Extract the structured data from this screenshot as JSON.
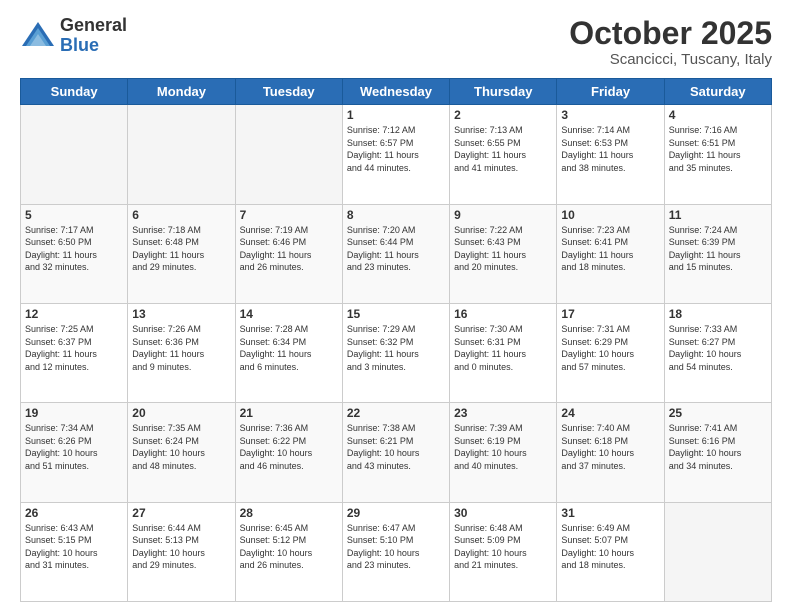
{
  "header": {
    "logo_general": "General",
    "logo_blue": "Blue",
    "month_title": "October 2025",
    "location": "Scancicci, Tuscany, Italy"
  },
  "days_of_week": [
    "Sunday",
    "Monday",
    "Tuesday",
    "Wednesday",
    "Thursday",
    "Friday",
    "Saturday"
  ],
  "weeks": [
    [
      {
        "day": "",
        "info": ""
      },
      {
        "day": "",
        "info": ""
      },
      {
        "day": "",
        "info": ""
      },
      {
        "day": "1",
        "info": "Sunrise: 7:12 AM\nSunset: 6:57 PM\nDaylight: 11 hours\nand 44 minutes."
      },
      {
        "day": "2",
        "info": "Sunrise: 7:13 AM\nSunset: 6:55 PM\nDaylight: 11 hours\nand 41 minutes."
      },
      {
        "day": "3",
        "info": "Sunrise: 7:14 AM\nSunset: 6:53 PM\nDaylight: 11 hours\nand 38 minutes."
      },
      {
        "day": "4",
        "info": "Sunrise: 7:16 AM\nSunset: 6:51 PM\nDaylight: 11 hours\nand 35 minutes."
      }
    ],
    [
      {
        "day": "5",
        "info": "Sunrise: 7:17 AM\nSunset: 6:50 PM\nDaylight: 11 hours\nand 32 minutes."
      },
      {
        "day": "6",
        "info": "Sunrise: 7:18 AM\nSunset: 6:48 PM\nDaylight: 11 hours\nand 29 minutes."
      },
      {
        "day": "7",
        "info": "Sunrise: 7:19 AM\nSunset: 6:46 PM\nDaylight: 11 hours\nand 26 minutes."
      },
      {
        "day": "8",
        "info": "Sunrise: 7:20 AM\nSunset: 6:44 PM\nDaylight: 11 hours\nand 23 minutes."
      },
      {
        "day": "9",
        "info": "Sunrise: 7:22 AM\nSunset: 6:43 PM\nDaylight: 11 hours\nand 20 minutes."
      },
      {
        "day": "10",
        "info": "Sunrise: 7:23 AM\nSunset: 6:41 PM\nDaylight: 11 hours\nand 18 minutes."
      },
      {
        "day": "11",
        "info": "Sunrise: 7:24 AM\nSunset: 6:39 PM\nDaylight: 11 hours\nand 15 minutes."
      }
    ],
    [
      {
        "day": "12",
        "info": "Sunrise: 7:25 AM\nSunset: 6:37 PM\nDaylight: 11 hours\nand 12 minutes."
      },
      {
        "day": "13",
        "info": "Sunrise: 7:26 AM\nSunset: 6:36 PM\nDaylight: 11 hours\nand 9 minutes."
      },
      {
        "day": "14",
        "info": "Sunrise: 7:28 AM\nSunset: 6:34 PM\nDaylight: 11 hours\nand 6 minutes."
      },
      {
        "day": "15",
        "info": "Sunrise: 7:29 AM\nSunset: 6:32 PM\nDaylight: 11 hours\nand 3 minutes."
      },
      {
        "day": "16",
        "info": "Sunrise: 7:30 AM\nSunset: 6:31 PM\nDaylight: 11 hours\nand 0 minutes."
      },
      {
        "day": "17",
        "info": "Sunrise: 7:31 AM\nSunset: 6:29 PM\nDaylight: 10 hours\nand 57 minutes."
      },
      {
        "day": "18",
        "info": "Sunrise: 7:33 AM\nSunset: 6:27 PM\nDaylight: 10 hours\nand 54 minutes."
      }
    ],
    [
      {
        "day": "19",
        "info": "Sunrise: 7:34 AM\nSunset: 6:26 PM\nDaylight: 10 hours\nand 51 minutes."
      },
      {
        "day": "20",
        "info": "Sunrise: 7:35 AM\nSunset: 6:24 PM\nDaylight: 10 hours\nand 48 minutes."
      },
      {
        "day": "21",
        "info": "Sunrise: 7:36 AM\nSunset: 6:22 PM\nDaylight: 10 hours\nand 46 minutes."
      },
      {
        "day": "22",
        "info": "Sunrise: 7:38 AM\nSunset: 6:21 PM\nDaylight: 10 hours\nand 43 minutes."
      },
      {
        "day": "23",
        "info": "Sunrise: 7:39 AM\nSunset: 6:19 PM\nDaylight: 10 hours\nand 40 minutes."
      },
      {
        "day": "24",
        "info": "Sunrise: 7:40 AM\nSunset: 6:18 PM\nDaylight: 10 hours\nand 37 minutes."
      },
      {
        "day": "25",
        "info": "Sunrise: 7:41 AM\nSunset: 6:16 PM\nDaylight: 10 hours\nand 34 minutes."
      }
    ],
    [
      {
        "day": "26",
        "info": "Sunrise: 6:43 AM\nSunset: 5:15 PM\nDaylight: 10 hours\nand 31 minutes."
      },
      {
        "day": "27",
        "info": "Sunrise: 6:44 AM\nSunset: 5:13 PM\nDaylight: 10 hours\nand 29 minutes."
      },
      {
        "day": "28",
        "info": "Sunrise: 6:45 AM\nSunset: 5:12 PM\nDaylight: 10 hours\nand 26 minutes."
      },
      {
        "day": "29",
        "info": "Sunrise: 6:47 AM\nSunset: 5:10 PM\nDaylight: 10 hours\nand 23 minutes."
      },
      {
        "day": "30",
        "info": "Sunrise: 6:48 AM\nSunset: 5:09 PM\nDaylight: 10 hours\nand 21 minutes."
      },
      {
        "day": "31",
        "info": "Sunrise: 6:49 AM\nSunset: 5:07 PM\nDaylight: 10 hours\nand 18 minutes."
      },
      {
        "day": "",
        "info": ""
      }
    ]
  ]
}
